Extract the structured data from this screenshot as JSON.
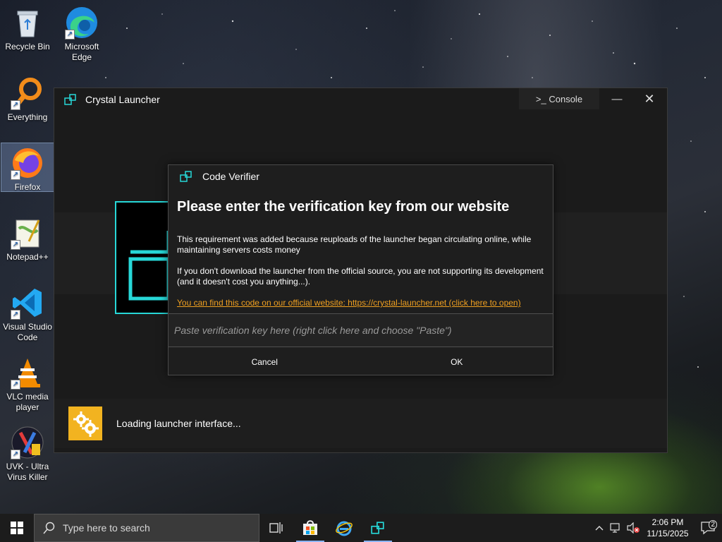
{
  "desktop": {
    "icons": [
      {
        "label": "Recycle Bin",
        "icon": "recycle-bin-icon"
      },
      {
        "label": "Microsoft Edge",
        "icon": "edge-icon"
      },
      {
        "label": "Everything",
        "icon": "everything-search-icon"
      },
      {
        "label": "Firefox",
        "icon": "firefox-icon"
      },
      {
        "label": "Notepad++",
        "icon": "notepadpp-icon"
      },
      {
        "label": "Visual Studio Code",
        "icon": "vscode-icon"
      },
      {
        "label": "VLC media player",
        "icon": "vlc-icon"
      },
      {
        "label": "UVK - Ultra Virus Killer",
        "icon": "uvk-icon"
      }
    ]
  },
  "launcher": {
    "title": "Crystal Launcher",
    "console_label": ">_ Console",
    "minimize_glyph": "—",
    "close_glyph": "✕",
    "status_text": "Loading launcher interface...",
    "accent": "#27d8d8",
    "status_icon_color": "#f2b320"
  },
  "dialog": {
    "title": "Code Verifier",
    "heading": "Please enter the verification key from our website",
    "paragraph1": "This requirement was added because reuploads of the launcher began circulating online, while maintaining servers costs money",
    "paragraph2": "If you don't download the launcher from the official source, you are not supporting its development (and it doesn't cost you anything...).",
    "link_text": "You can find this code on our official website: https://crystal-launcher.net (click here to open)",
    "input_placeholder": "Paste verification key here (right click here and choose \"Paste\")",
    "input_value": "",
    "cancel_label": "Cancel",
    "ok_label": "OK",
    "link_color": "#f0a020"
  },
  "taskbar": {
    "search_placeholder": "Type here to search",
    "time": "2:06 PM",
    "date": "11/15/2025",
    "notification_count": "2",
    "pinned": [
      "task-view-icon",
      "microsoft-store-icon",
      "internet-explorer-icon",
      "crystal-launcher-icon"
    ]
  }
}
